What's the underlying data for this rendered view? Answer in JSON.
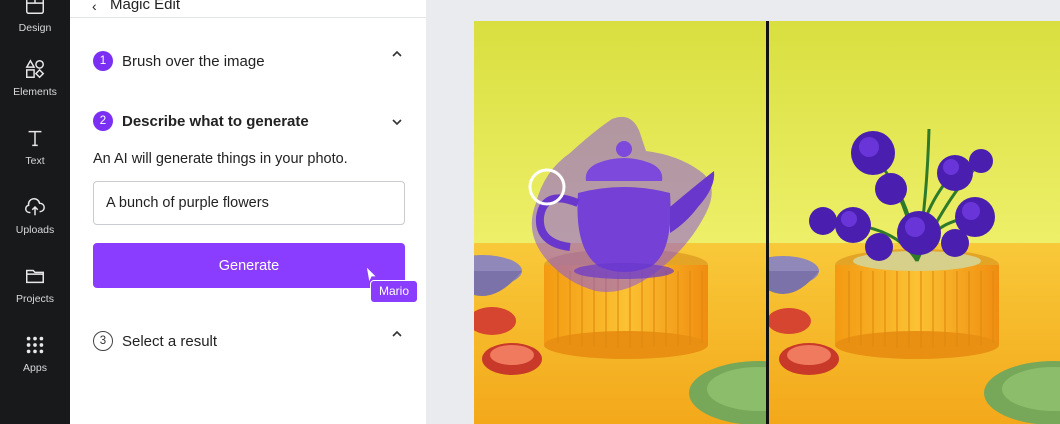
{
  "rail": {
    "items": [
      {
        "label": "Design",
        "icon": "design-icon"
      },
      {
        "label": "Elements",
        "icon": "elements-icon"
      },
      {
        "label": "Text",
        "icon": "text-icon"
      },
      {
        "label": "Uploads",
        "icon": "uploads-icon"
      },
      {
        "label": "Projects",
        "icon": "projects-icon"
      },
      {
        "label": "Apps",
        "icon": "apps-icon"
      }
    ]
  },
  "panel": {
    "title": "Magic Edit",
    "steps": [
      {
        "number": "1",
        "label": "Brush over the image",
        "state": "collapsed"
      },
      {
        "number": "2",
        "label": "Describe what to generate",
        "state": "expanded"
      },
      {
        "number": "3",
        "label": "Select a result",
        "state": "collapsed"
      }
    ],
    "description": "An AI will generate things in your photo.",
    "prompt_value": "A bunch of purple flowers",
    "generate_label": "Generate",
    "collaborator_name": "Mario"
  },
  "colors": {
    "accent": "#8b3dff",
    "rail_bg": "#18191b",
    "wall_yellow": "#e3e64a",
    "table_orange": "#f6b21d",
    "brush_purple": "#8a56e0",
    "flower_purple": "#4a1fb0"
  }
}
